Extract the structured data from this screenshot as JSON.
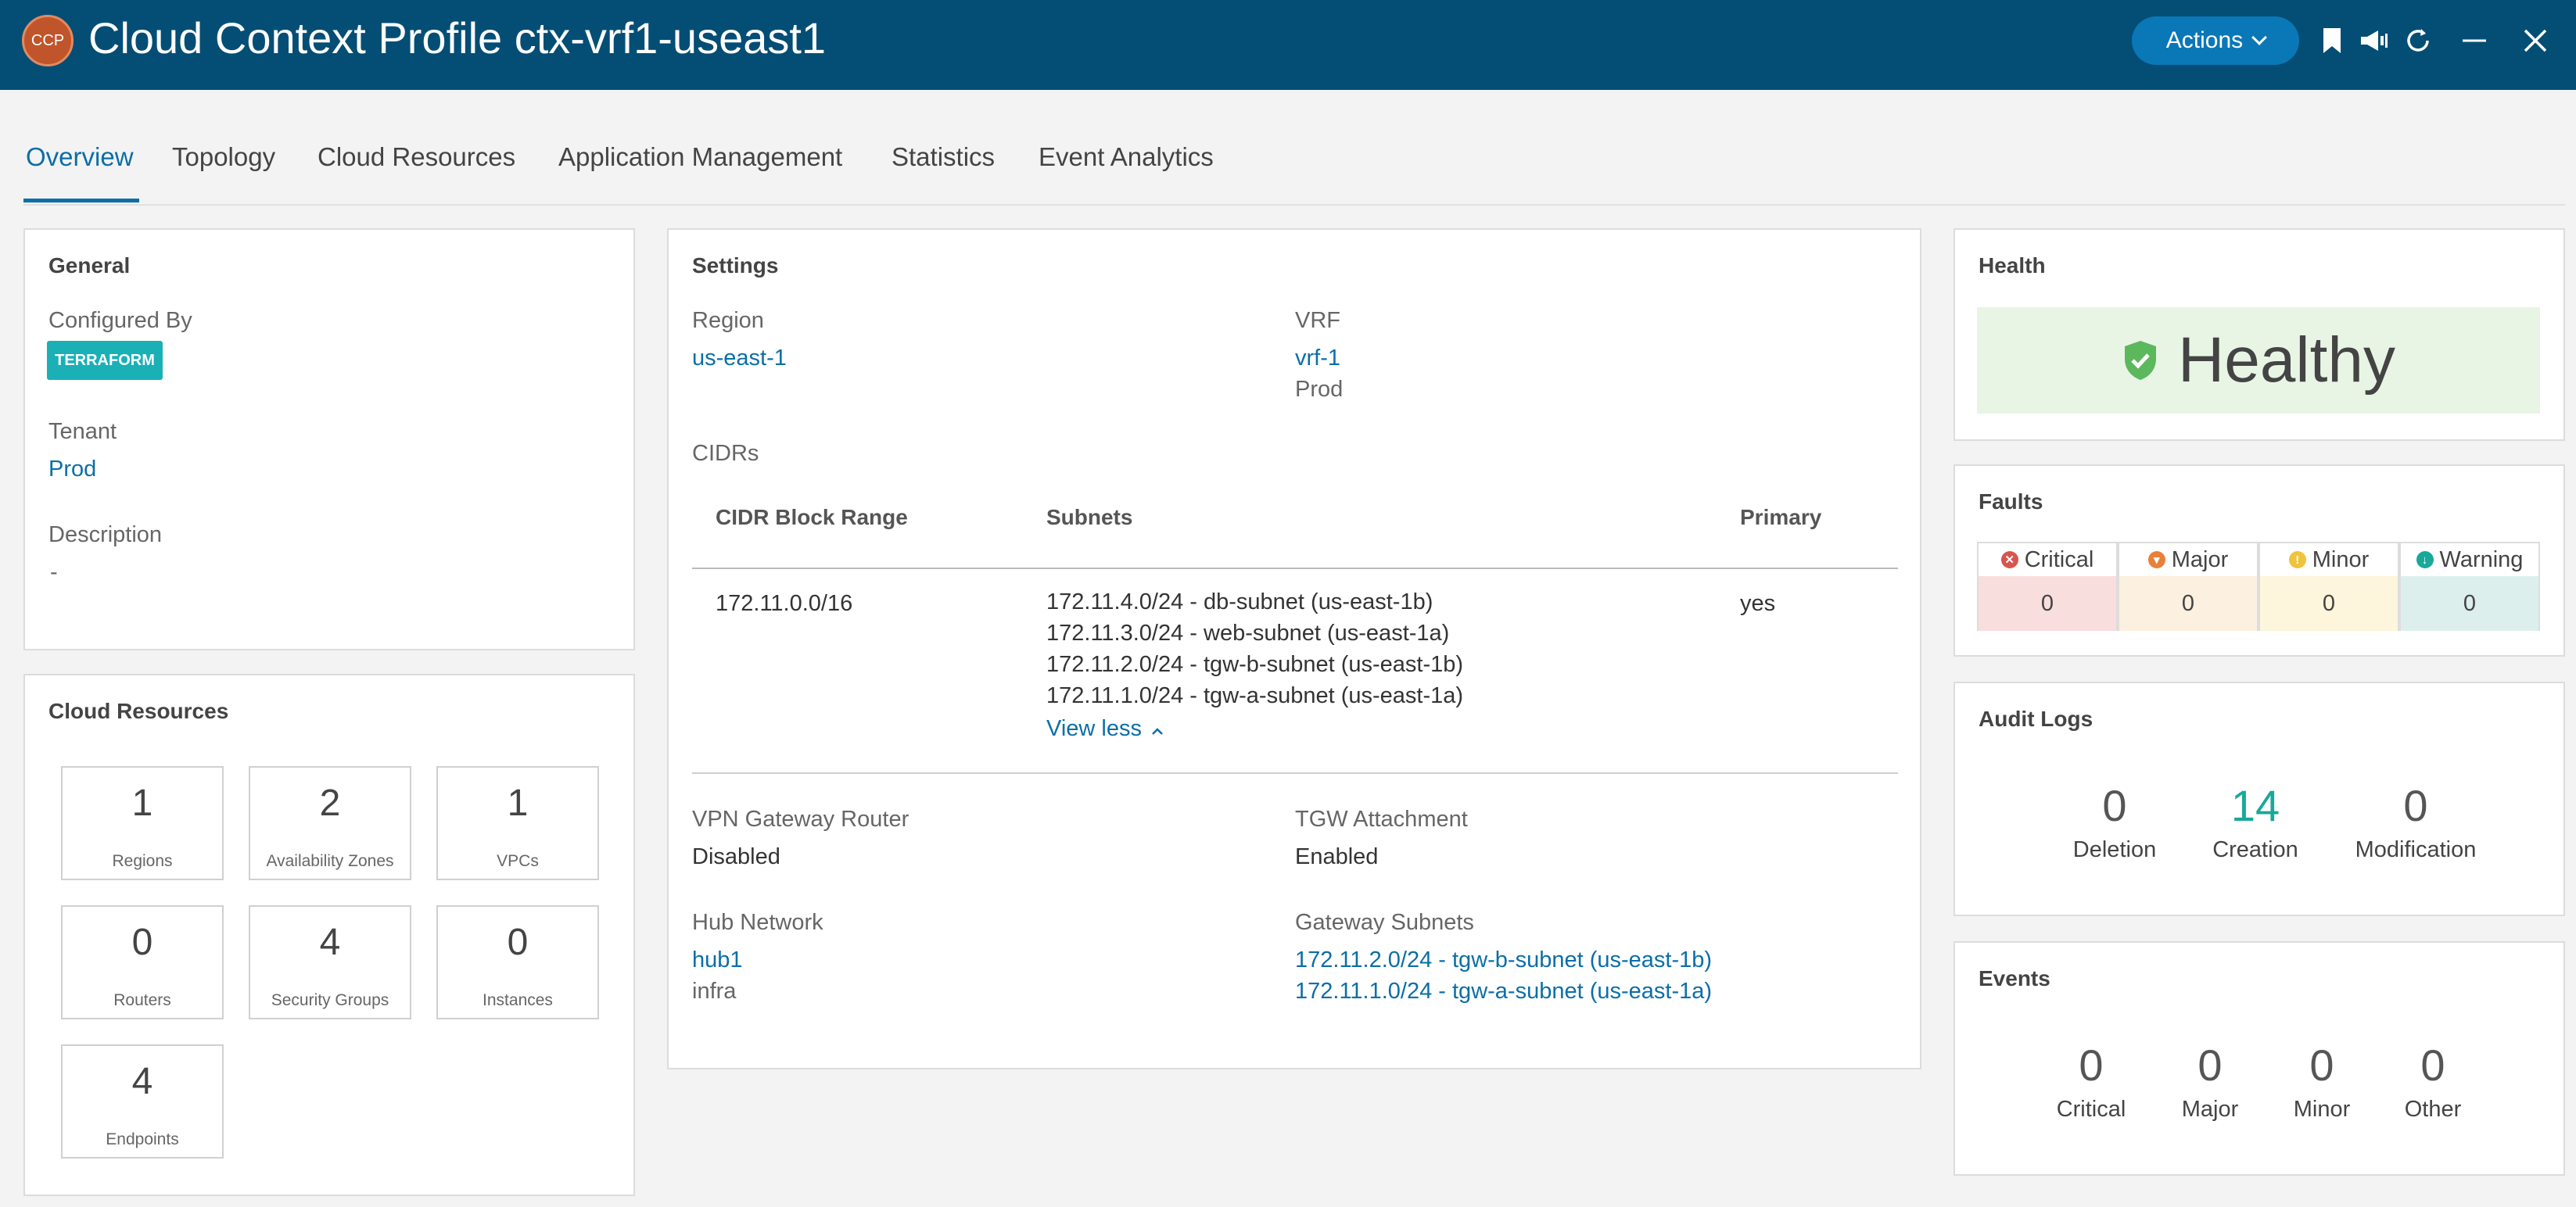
{
  "header": {
    "logo": "CCP",
    "title": "Cloud Context Profile ctx-vrf1-useast1",
    "actions_label": "Actions",
    "icons": [
      "bookmark-icon",
      "announcement-icon",
      "refresh-icon",
      "minimize-icon",
      "close-icon"
    ]
  },
  "tabs": [
    "Overview",
    "Topology",
    "Cloud Resources",
    "Application Management",
    "Statistics",
    "Event Analytics"
  ],
  "general": {
    "title": "General",
    "configured_by_label": "Configured By",
    "configured_by_value": "TERRAFORM",
    "tenant_label": "Tenant",
    "tenant_value": "Prod",
    "description_label": "Description",
    "description_value": "-"
  },
  "cloud_resources": {
    "title": "Cloud Resources",
    "tiles": [
      {
        "count": "1",
        "label": "Regions"
      },
      {
        "count": "2",
        "label": "Availability Zones"
      },
      {
        "count": "1",
        "label": "VPCs"
      },
      {
        "count": "0",
        "label": "Routers"
      },
      {
        "count": "4",
        "label": "Security Groups"
      },
      {
        "count": "0",
        "label": "Instances"
      },
      {
        "count": "4",
        "label": "Endpoints"
      }
    ]
  },
  "settings": {
    "title": "Settings",
    "region_label": "Region",
    "region_value": "us-east-1",
    "vrf_label": "VRF",
    "vrf_value": "vrf-1",
    "vrf_tenant": "Prod",
    "cidrs_label": "CIDRs",
    "table": {
      "headers": [
        "CIDR Block Range",
        "Subnets",
        "Primary"
      ],
      "row": {
        "cidr": "172.11.0.0/16",
        "subnets": [
          "172.11.4.0/24 - db-subnet (us-east-1b)",
          "172.11.3.0/24 - web-subnet (us-east-1a)",
          "172.11.2.0/24 - tgw-b-subnet (us-east-1b)",
          "172.11.1.0/24 - tgw-a-subnet (us-east-1a)"
        ],
        "primary": "yes",
        "view_less": "View less"
      }
    },
    "vpn_label": "VPN Gateway Router",
    "vpn_value": "Disabled",
    "tgw_label": "TGW Attachment",
    "tgw_value": "Enabled",
    "hub_label": "Hub Network",
    "hub_value": "hub1",
    "hub_tenant": "infra",
    "gw_subnets_label": "Gateway Subnets",
    "gw_subnets": [
      "172.11.2.0/24 - tgw-b-subnet (us-east-1b)",
      "172.11.1.0/24 - tgw-a-subnet (us-east-1a)"
    ]
  },
  "health": {
    "title": "Health",
    "status": "Healthy"
  },
  "faults": {
    "title": "Faults",
    "items": [
      {
        "label": "Critical",
        "value": "0",
        "color": "#d9534f",
        "bg": "#f9dede"
      },
      {
        "label": "Major",
        "value": "0",
        "color": "#e8803a",
        "bg": "#fcf0e0"
      },
      {
        "label": "Minor",
        "value": "0",
        "color": "#f0c33c",
        "bg": "#fdf5dc"
      },
      {
        "label": "Warning",
        "value": "0",
        "color": "#1aa89a",
        "bg": "#dcefec"
      }
    ]
  },
  "audit_logs": {
    "title": "Audit Logs",
    "items": [
      {
        "count": "0",
        "label": "Deletion"
      },
      {
        "count": "14",
        "label": "Creation"
      },
      {
        "count": "0",
        "label": "Modification"
      }
    ]
  },
  "events": {
    "title": "Events",
    "items": [
      {
        "count": "0",
        "label": "Critical"
      },
      {
        "count": "0",
        "label": "Major"
      },
      {
        "count": "0",
        "label": "Minor"
      },
      {
        "count": "0",
        "label": "Other"
      }
    ]
  }
}
